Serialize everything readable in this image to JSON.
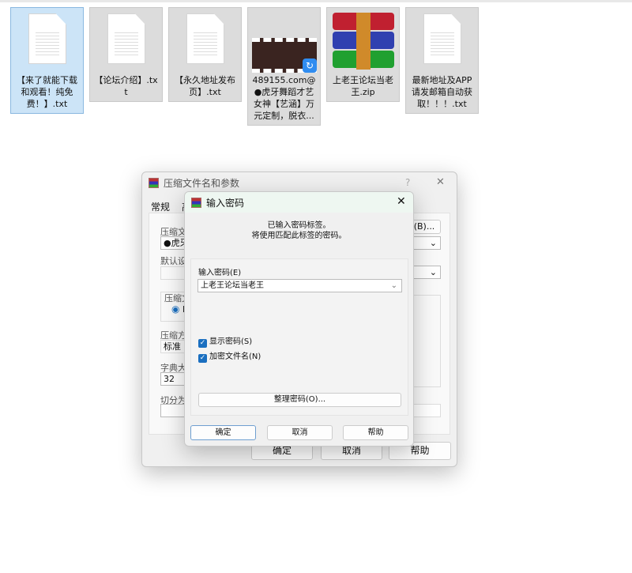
{
  "files": [
    {
      "name": "【来了就能下载和观看！纯免费！】.txt",
      "type": "txt",
      "selected": true
    },
    {
      "name": "【论坛介绍】.txt",
      "type": "txt"
    },
    {
      "name": "【永久地址发布页】.txt",
      "type": "txt"
    },
    {
      "name": "489155.com@●虎牙舞蹈才艺女神【艺涵】万元定制，脱衣...",
      "type": "video"
    },
    {
      "name": "上老王论坛当老王.zip",
      "type": "zip"
    },
    {
      "name": "最新地址及APP请发邮箱自动获取！！！.txt",
      "type": "txt"
    }
  ],
  "back_dialog": {
    "title": "压缩文件名和参数",
    "help": "?",
    "close": "✕",
    "tabs": [
      "常规",
      "高"
    ],
    "archive_name_label": "压缩文件",
    "archive_name_value": "●虎牙",
    "browse": "(B)...",
    "profile_label": "默认设置",
    "format_label": "压缩文",
    "format_radio": "R",
    "method_label": "压缩方式",
    "method_value": "标准",
    "dict_label": "字典大小",
    "dict_value": "32",
    "split_label": "切分为分",
    "ok": "确定",
    "cancel": "取消",
    "help_btn": "帮助"
  },
  "password_dialog": {
    "title": "输入密码",
    "close": "✕",
    "message1": "已输入密码标签。",
    "message2": "将使用匹配此标签的密码。",
    "password_label": "输入密码(E)",
    "password_value": "上老王论坛当老王",
    "show_password": "显示密码(S)",
    "show_password_checked": true,
    "encrypt_names": "加密文件名(N)",
    "encrypt_names_checked": true,
    "organize": "整理密码(O)...",
    "ok": "确定",
    "cancel": "取消",
    "help": "帮助"
  }
}
